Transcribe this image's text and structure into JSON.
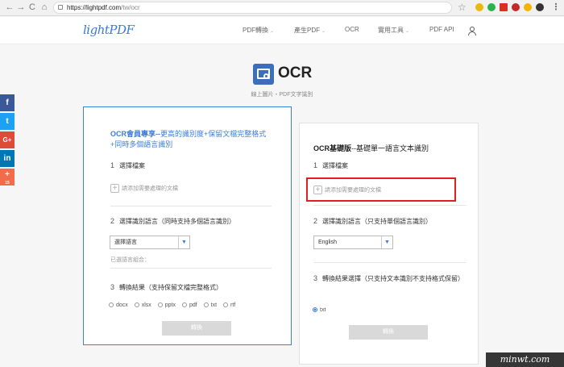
{
  "browser": {
    "url_host": "https://lightpdf.com",
    "url_path": "/tw/ocr",
    "nav": [
      "←",
      "→",
      "C",
      "⌂"
    ],
    "extension_colors": [
      "#e8b90f",
      "#2bb24c",
      "#d93025",
      "#c62828",
      "#f4b400",
      "#333333"
    ]
  },
  "header": {
    "logo_text": "lightPDF",
    "menu": [
      {
        "label": "PDF轉換",
        "has_caret": true
      },
      {
        "label": "產生PDF",
        "has_caret": true
      },
      {
        "label": "OCR",
        "has_caret": false
      },
      {
        "label": "實用工具",
        "has_caret": true
      },
      {
        "label": "PDF API",
        "has_caret": false
      }
    ],
    "caret": "⌄"
  },
  "hero": {
    "title": "OCR",
    "subtitle": "線上圖片・PDF文字識別"
  },
  "social": [
    {
      "label": "f",
      "color": "#3b5998"
    },
    {
      "label": "t",
      "color": "#1da1f2"
    },
    {
      "label": "G+",
      "color": "#dd4b39"
    },
    {
      "label": "in",
      "color": "#0077b5"
    },
    {
      "label": "+",
      "color": "#f26b4a",
      "count": "15"
    }
  ],
  "left_card": {
    "title_bold": "OCR會員專享--",
    "title_rest": "更高的識別度+保留文檔完整格式+同時多個語言識別",
    "step1_num": "1",
    "step1_label": "選擇檔案",
    "add_file": "請添加需要處理的文檔",
    "step2_num": "2",
    "step2_label": "選擇識別語言（同時支持多個語言識別）",
    "select_value": "選擇語言",
    "select_arrow": "▼",
    "selected_hint": "已選語言組合：",
    "step3_num": "3",
    "step3_label": "轉換結果（支持保留文檔完整格式）",
    "formats": [
      "docx",
      "xlsx",
      "pptx",
      "pdf",
      "txt",
      "rtf"
    ],
    "convert_label": "轉換"
  },
  "right_card": {
    "title_bold": "OCR基礎版",
    "title_rest": "--基礎單一語言文本識別",
    "step1_num": "1",
    "step1_label": "選擇檔案",
    "add_file": "請添加需要處理的文檔",
    "step2_num": "2",
    "step2_label": "選擇識別語言（只支持單個語言識別）",
    "select_value": "English",
    "select_arrow": "▼",
    "step3_num": "3",
    "step3_label": "轉換結果選擇（只支持文本識別不支持格式保留）",
    "formats": [
      "txt"
    ],
    "convert_label": "轉換"
  },
  "watermark": "minwt.com",
  "colors": {
    "accent": "#3d7fd8",
    "highlight": "#e02020"
  }
}
